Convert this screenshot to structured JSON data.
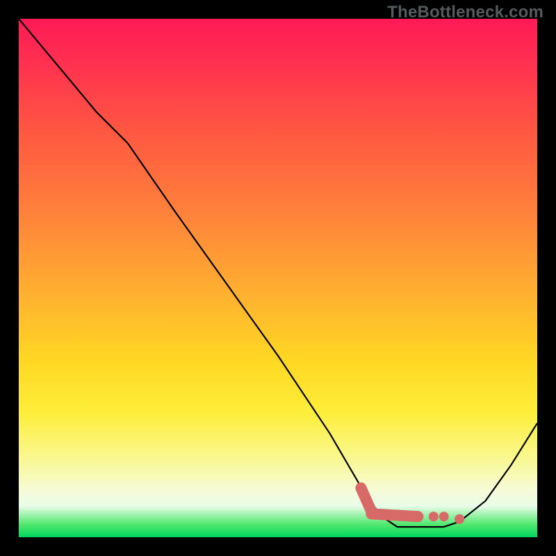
{
  "watermark": "TheBottleneck.com",
  "chart_data": {
    "type": "line",
    "title": "",
    "xlabel": "",
    "ylabel": "",
    "xlim": [
      0,
      1
    ],
    "ylim": [
      0,
      1
    ],
    "series": [
      {
        "name": "curve",
        "x": [
          0.0,
          0.05,
          0.1,
          0.15,
          0.21,
          0.3,
          0.4,
          0.5,
          0.6,
          0.67,
          0.7,
          0.73,
          0.76,
          0.8,
          0.82,
          0.85,
          0.9,
          0.95,
          1.0
        ],
        "y": [
          1.0,
          0.94,
          0.88,
          0.82,
          0.76,
          0.63,
          0.49,
          0.35,
          0.2,
          0.08,
          0.04,
          0.02,
          0.02,
          0.02,
          0.02,
          0.03,
          0.07,
          0.14,
          0.22
        ]
      }
    ],
    "highlight": {
      "name": "salmon-marks",
      "segments": [
        {
          "x": [
            0.66,
            0.68
          ],
          "y": [
            0.095,
            0.05
          ]
        },
        {
          "x": [
            0.68,
            0.77
          ],
          "y": [
            0.045,
            0.04
          ]
        }
      ],
      "dots": [
        {
          "x": 0.8,
          "y": 0.04
        },
        {
          "x": 0.82,
          "y": 0.04
        },
        {
          "x": 0.85,
          "y": 0.035
        }
      ]
    },
    "background_gradient": {
      "top": "#ff1a55",
      "mid": "#ffd823",
      "bottom": "#00d85e"
    }
  }
}
